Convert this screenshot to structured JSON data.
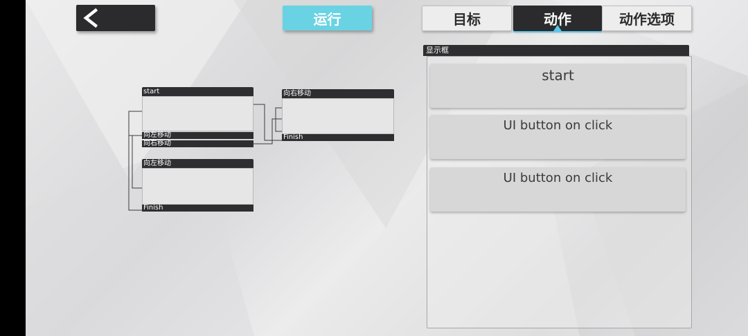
{
  "toolbar": {
    "back_icon": "chevron-left-icon",
    "run_label": "运行"
  },
  "tabs": [
    {
      "label": "目标",
      "active": false
    },
    {
      "label": "动作",
      "active": true
    },
    {
      "label": "动作选项",
      "active": false
    }
  ],
  "graph": {
    "node_start": {
      "title": "start",
      "rows": [
        "向左移动",
        "向右移动"
      ]
    },
    "node_left": {
      "title": "向左移动",
      "rows": [
        "Finish"
      ]
    },
    "node_right": {
      "title": "向右移动",
      "rows": [
        "Finish"
      ]
    }
  },
  "panel": {
    "title": "显示框",
    "cards": [
      "start",
      "UI button on click",
      "UI button on click"
    ]
  },
  "colors": {
    "accent": "#69d3e3",
    "dark": "#2b2b2d",
    "tab_marker": "#5cc6e8"
  }
}
